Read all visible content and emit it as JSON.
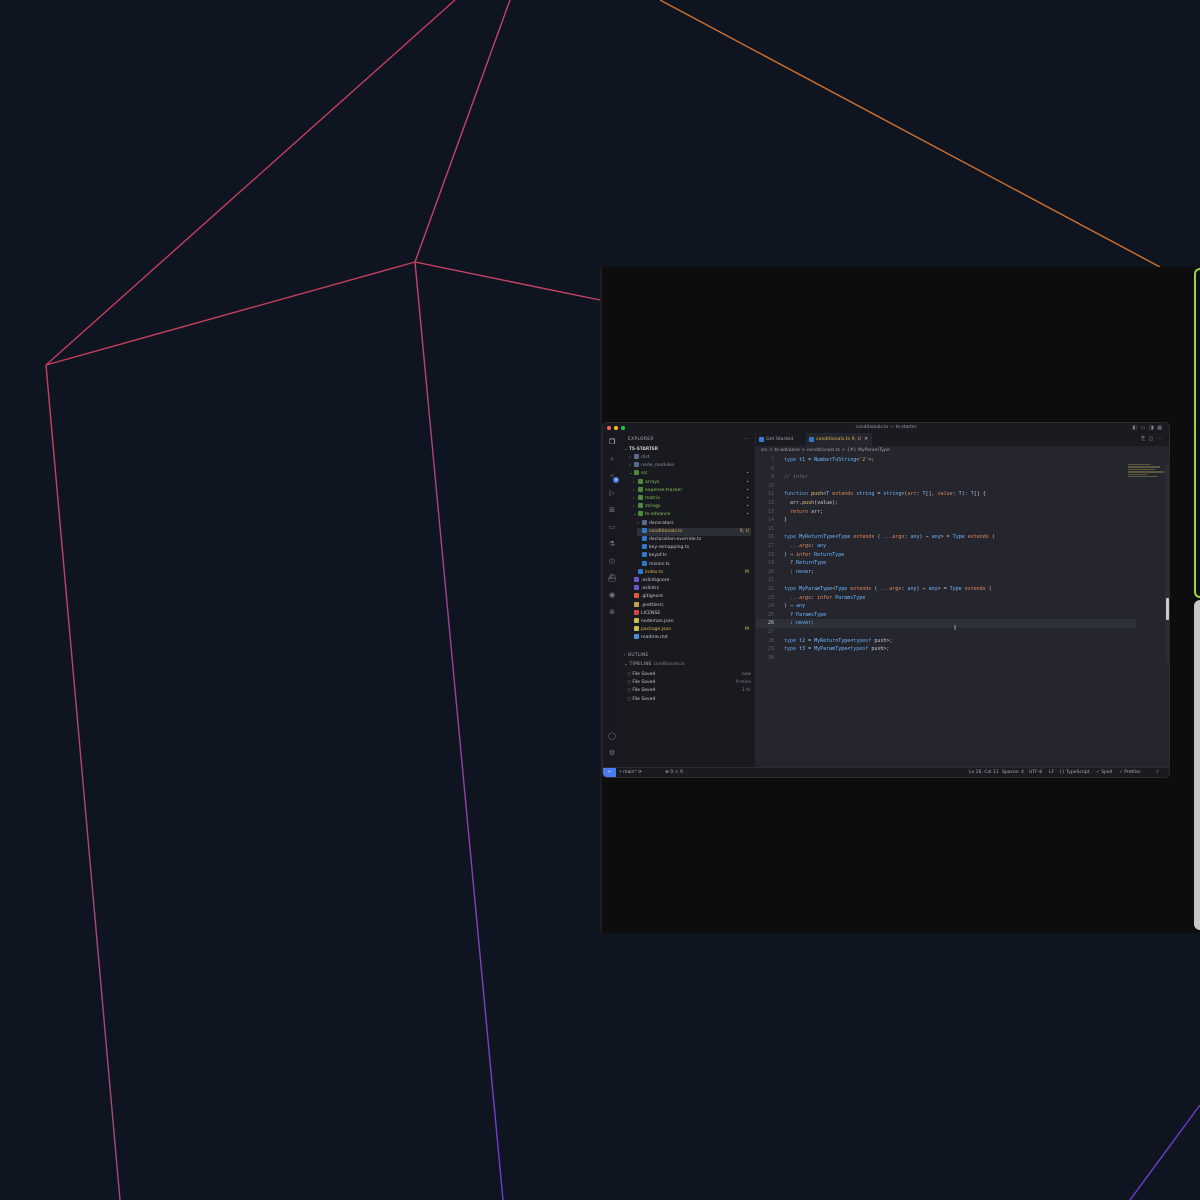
{
  "window": {
    "title": "conditionals.ts — ts-starter",
    "controls": [
      "close",
      "minimize",
      "zoom"
    ],
    "colors": {
      "close": "#ff5f57",
      "minimize": "#febc2e",
      "zoom": "#28c840"
    }
  },
  "activity_bar": {
    "items": [
      "explorer-icon",
      "search-icon",
      "source-control-icon",
      "run-debug-icon",
      "extensions-icon",
      "remote-explorer-icon",
      "testing-icon",
      "timeline-icon",
      "docker-icon",
      "github-icon",
      "gitlens-icon"
    ],
    "badge": "9",
    "bottom": [
      "account-icon",
      "settings-gear-icon"
    ]
  },
  "explorer": {
    "header": "EXPLORER",
    "project": "TS-STARTER",
    "tree": [
      {
        "label": "dist",
        "depth": 1,
        "kind": "folder",
        "expanded": false,
        "color": "#8a8c99",
        "badge": ""
      },
      {
        "label": "node_modules",
        "depth": 1,
        "kind": "folder",
        "expanded": false,
        "color": "#8a8c99",
        "badge": ""
      },
      {
        "label": "src",
        "depth": 1,
        "kind": "folder",
        "expanded": true,
        "color": "#88c057",
        "badge": "•"
      },
      {
        "label": "arrays",
        "depth": 2,
        "kind": "folder",
        "expanded": false,
        "color": "#88c057",
        "badge": "•"
      },
      {
        "label": "expense-tracker",
        "depth": 2,
        "kind": "folder",
        "expanded": false,
        "color": "#88c057",
        "badge": "•"
      },
      {
        "label": "matrix",
        "depth": 2,
        "kind": "folder",
        "expanded": false,
        "color": "#88c057",
        "badge": "•"
      },
      {
        "label": "strings",
        "depth": 2,
        "kind": "folder",
        "expanded": false,
        "color": "#88c057",
        "badge": "•"
      },
      {
        "label": "ts-advance",
        "depth": 2,
        "kind": "folder",
        "expanded": true,
        "color": "#88c057",
        "badge": "•"
      },
      {
        "label": "decorators",
        "depth": 3,
        "kind": "folder",
        "expanded": false,
        "color": "#c7c9d1",
        "badge": ""
      },
      {
        "label": "conditionals.ts",
        "depth": 3,
        "kind": "ts",
        "selected": true,
        "color": "#e0b84f",
        "badge": "9, U"
      },
      {
        "label": "declaration-override.ts",
        "depth": 3,
        "kind": "ts",
        "color": "#c7c9d1",
        "badge": ""
      },
      {
        "label": "key-remapping.ts",
        "depth": 3,
        "kind": "ts",
        "color": "#c7c9d1",
        "badge": ""
      },
      {
        "label": "keyof.ts",
        "depth": 3,
        "kind": "ts",
        "color": "#c7c9d1",
        "badge": ""
      },
      {
        "label": "mixins.ts",
        "depth": 3,
        "kind": "ts",
        "color": "#c7c9d1",
        "badge": ""
      },
      {
        "label": "index.ts",
        "depth": 2,
        "kind": "ts",
        "color": "#e0b84f",
        "badge": "M"
      },
      {
        "label": ".eslintignore",
        "depth": 1,
        "kind": "eslint",
        "color": "#c7c9d1",
        "badge": ""
      },
      {
        "label": ".eslintrc",
        "depth": 1,
        "kind": "eslint",
        "color": "#c7c9d1",
        "badge": ""
      },
      {
        "label": ".gitignore",
        "depth": 1,
        "kind": "git",
        "color": "#c7c9d1",
        "badge": ""
      },
      {
        "label": ".prettierrc",
        "depth": 1,
        "kind": "prettier",
        "color": "#c7c9d1",
        "badge": ""
      },
      {
        "label": "LICENSE",
        "depth": 1,
        "kind": "license",
        "color": "#c7c9d1",
        "badge": ""
      },
      {
        "label": "nodemon.json",
        "depth": 1,
        "kind": "json",
        "color": "#c7c9d1",
        "badge": ""
      },
      {
        "label": "package.json",
        "depth": 1,
        "kind": "json",
        "color": "#e0b84f",
        "badge": "M"
      },
      {
        "label": "readme.md",
        "depth": 1,
        "kind": "md",
        "color": "#c7c9d1",
        "badge": ""
      }
    ],
    "outline_header": "OUTLINE",
    "timeline_header": "TIMELINE",
    "timeline_file": "conditionals.ts",
    "timeline": [
      {
        "label": "File Saved",
        "time": "now"
      },
      {
        "label": "File Saved",
        "time": "9 mins"
      },
      {
        "label": "File Saved",
        "time": "1 hr"
      },
      {
        "label": "File Saved",
        "time": ""
      }
    ]
  },
  "tabs": [
    {
      "label": "Get Started",
      "active": false
    },
    {
      "label": "conditionals.ts 9, U",
      "active": true
    }
  ],
  "breadcrumb": "src > ts-advance > conditionals.ts > {#} MyParamType",
  "code_lines": [
    {
      "n": "7",
      "t": [
        [
          "kw",
          "type "
        ],
        [
          "type",
          "t1"
        ],
        [
          "pl",
          " = "
        ],
        [
          "type",
          "NumberToString"
        ],
        [
          "pl",
          "<"
        ],
        [
          "str",
          "'2'"
        ],
        [
          "pl",
          ">;"
        ]
      ]
    },
    {
      "n": "8",
      "t": []
    },
    {
      "n": "9",
      "t": [
        [
          "com",
          "// infer"
        ]
      ]
    },
    {
      "n": "10",
      "t": []
    },
    {
      "n": "11",
      "t": [
        [
          "kw",
          "function "
        ],
        [
          "fn",
          "push"
        ],
        [
          "pl",
          "<"
        ],
        [
          "type",
          "T"
        ],
        [
          "org",
          " extends "
        ],
        [
          "type",
          "string"
        ],
        [
          "pl",
          " = "
        ],
        [
          "type",
          "string"
        ],
        [
          "pl",
          ">("
        ],
        [
          "it",
          "arr"
        ],
        [
          "pl",
          ": "
        ],
        [
          "type",
          "T"
        ],
        [
          "pl",
          "[], "
        ],
        [
          "it",
          "value"
        ],
        [
          "pl",
          ": "
        ],
        [
          "type",
          "T"
        ],
        [
          "pl",
          "): "
        ],
        [
          "type",
          "T"
        ],
        [
          "pl",
          "[] {"
        ]
      ]
    },
    {
      "n": "12",
      "t": [
        [
          "pl",
          "  arr."
        ],
        [
          "fn",
          "push"
        ],
        [
          "pl",
          "(value);"
        ]
      ]
    },
    {
      "n": "13",
      "t": [
        [
          "org",
          "  return "
        ],
        [
          "pl",
          "arr;"
        ]
      ]
    },
    {
      "n": "14",
      "t": [
        [
          "pl",
          "}"
        ]
      ]
    },
    {
      "n": "15",
      "t": []
    },
    {
      "n": "16",
      "t": [
        [
          "kw",
          "type "
        ],
        [
          "type",
          "MyReturnType"
        ],
        [
          "pl",
          "<"
        ],
        [
          "type",
          "Type"
        ],
        [
          "org",
          " extends "
        ],
        [
          "pl",
          "("
        ],
        [
          "pur",
          " ..."
        ],
        [
          "it",
          "args"
        ],
        [
          "pl",
          ": "
        ],
        [
          "type",
          "any"
        ],
        [
          "pl",
          ") ⇒ "
        ],
        [
          "type",
          "any"
        ],
        [
          "pl",
          "> = "
        ],
        [
          "type",
          "Type"
        ],
        [
          "org",
          " extends "
        ],
        [
          "pl",
          "("
        ]
      ]
    },
    {
      "n": "17",
      "t": [
        [
          "pur",
          "  ..."
        ],
        [
          "it",
          "args"
        ],
        [
          "pl",
          ": "
        ],
        [
          "type",
          "any"
        ]
      ]
    },
    {
      "n": "18",
      "t": [
        [
          "pl",
          ") ⇒ "
        ],
        [
          "org",
          "infer "
        ],
        [
          "type",
          "ReturnType"
        ]
      ]
    },
    {
      "n": "19",
      "t": [
        [
          "pl",
          "  ? "
        ],
        [
          "type",
          "ReturnType"
        ]
      ]
    },
    {
      "n": "20",
      "t": [
        [
          "pl",
          "  : "
        ],
        [
          "type",
          "never"
        ],
        [
          "pl",
          ";"
        ]
      ]
    },
    {
      "n": "21",
      "t": []
    },
    {
      "n": "22",
      "t": [
        [
          "kw",
          "type "
        ],
        [
          "type",
          "MyParamType"
        ],
        [
          "pl",
          "<"
        ],
        [
          "type",
          "Type"
        ],
        [
          "org",
          " extends "
        ],
        [
          "pl",
          "("
        ],
        [
          "pur",
          " ..."
        ],
        [
          "it",
          "args"
        ],
        [
          "pl",
          ": "
        ],
        [
          "type",
          "any"
        ],
        [
          "pl",
          ") ⇒ "
        ],
        [
          "type",
          "any"
        ],
        [
          "pl",
          "> = "
        ],
        [
          "type",
          "Type"
        ],
        [
          "org",
          " extends "
        ],
        [
          "pl",
          "("
        ]
      ]
    },
    {
      "n": "23",
      "t": [
        [
          "pur",
          "  ..."
        ],
        [
          "it",
          "args"
        ],
        [
          "pl",
          ": "
        ],
        [
          "org",
          "infer "
        ],
        [
          "type",
          "ParamsType"
        ]
      ]
    },
    {
      "n": "24",
      "t": [
        [
          "pl",
          ") ⇒ "
        ],
        [
          "type",
          "any"
        ]
      ]
    },
    {
      "n": "25",
      "t": [
        [
          "pl",
          "  ? "
        ],
        [
          "type",
          "ParamsType"
        ]
      ]
    },
    {
      "n": "26",
      "t": [
        [
          "pl",
          "  : "
        ],
        [
          "type",
          "never"
        ],
        [
          "pl",
          ";"
        ]
      ],
      "active": true
    },
    {
      "n": "27",
      "t": []
    },
    {
      "n": "28",
      "t": [
        [
          "kw",
          "type "
        ],
        [
          "type",
          "t2"
        ],
        [
          "pl",
          " = "
        ],
        [
          "type",
          "MyReturnType"
        ],
        [
          "pl",
          "<"
        ],
        [
          "kw",
          "typeof "
        ],
        [
          "pl",
          "push>;"
        ]
      ]
    },
    {
      "n": "29",
      "t": [
        [
          "kw",
          "type "
        ],
        [
          "type",
          "t3"
        ],
        [
          "pl",
          " = "
        ],
        [
          "type",
          "MyParamType"
        ],
        [
          "pl",
          "<"
        ],
        [
          "kw",
          "typeof "
        ],
        [
          "pl",
          "push>;"
        ]
      ]
    },
    {
      "n": "30",
      "t": []
    }
  ],
  "statusbar": {
    "branch": "main*",
    "problems": "⊗ 0 ⚠ 9",
    "position": "Ln 26, Col 11",
    "spaces": "Spaces: 4",
    "encoding": "UTF-8",
    "eol": "LF",
    "language": "{} TypeScript",
    "spell": "✓ Spell",
    "prettier": "✓ Prettier"
  },
  "colors": {
    "background": "#0f1520",
    "accent": "#4c7df0"
  }
}
